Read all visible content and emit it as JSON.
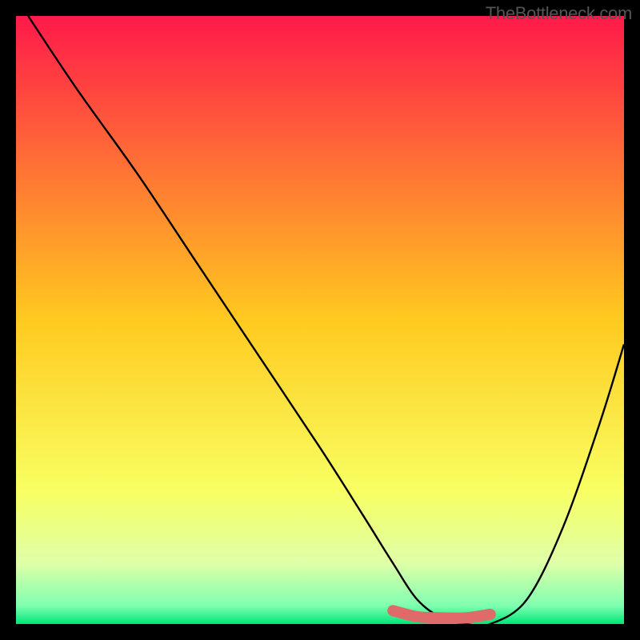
{
  "watermark": "TheBottleneck.com",
  "chart_data": {
    "type": "line",
    "title": "",
    "xlabel": "",
    "ylabel": "",
    "xlim": [
      0,
      100
    ],
    "ylim": [
      0,
      100
    ],
    "grid": false,
    "legend": false,
    "background_gradient": {
      "stops": [
        {
          "offset": 0.0,
          "color": "#ff1a4a"
        },
        {
          "offset": 0.5,
          "color": "#ffca1f"
        },
        {
          "offset": 0.78,
          "color": "#f8ff62"
        },
        {
          "offset": 0.9,
          "color": "#dfffa8"
        },
        {
          "offset": 0.97,
          "color": "#7fffb0"
        },
        {
          "offset": 1.0,
          "color": "#00e676"
        }
      ]
    },
    "series": [
      {
        "name": "bottleneck-curve",
        "color": "#000000",
        "x": [
          2,
          10,
          20,
          30,
          40,
          50,
          57,
          62,
          66,
          70,
          74,
          78,
          84,
          90,
          96,
          100
        ],
        "y": [
          100,
          88,
          74,
          59,
          44,
          29,
          18,
          10,
          4,
          1,
          0,
          0,
          4,
          16,
          33,
          46
        ]
      }
    ],
    "highlight_segment": {
      "name": "optimal-range",
      "color": "#e06a6a",
      "x": [
        62,
        66,
        70,
        74,
        78
      ],
      "y": [
        2.2,
        1.2,
        1.0,
        1.0,
        1.6
      ]
    }
  }
}
